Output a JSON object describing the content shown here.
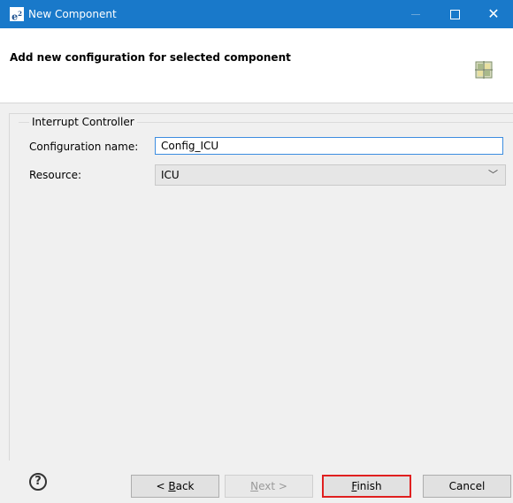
{
  "window": {
    "app_icon": "e²",
    "title": "New Component",
    "controls": {
      "minimize": "—",
      "maximize": "□",
      "close": "✕"
    }
  },
  "header": {
    "title": "Add new configuration for selected component",
    "icon": "component-grid-icon"
  },
  "group": {
    "label": "Interrupt Controller",
    "config_name_label": "Configuration name:",
    "config_name_value": "Config_ICU",
    "resource_label": "Resource:",
    "resource_value": "ICU",
    "resource_chevron": "﹀"
  },
  "footer": {
    "help": "?",
    "back_prefix": "< ",
    "back_mnemonic": "B",
    "back_rest": "ack",
    "next_mnemonic": "N",
    "next_rest": "ext >",
    "finish_mnemonic": "F",
    "finish_rest": "inish",
    "cancel": "Cancel"
  },
  "colors": {
    "titlebar": "#1979ca",
    "highlight": "#e02020",
    "input_focus": "#3c8de0"
  }
}
